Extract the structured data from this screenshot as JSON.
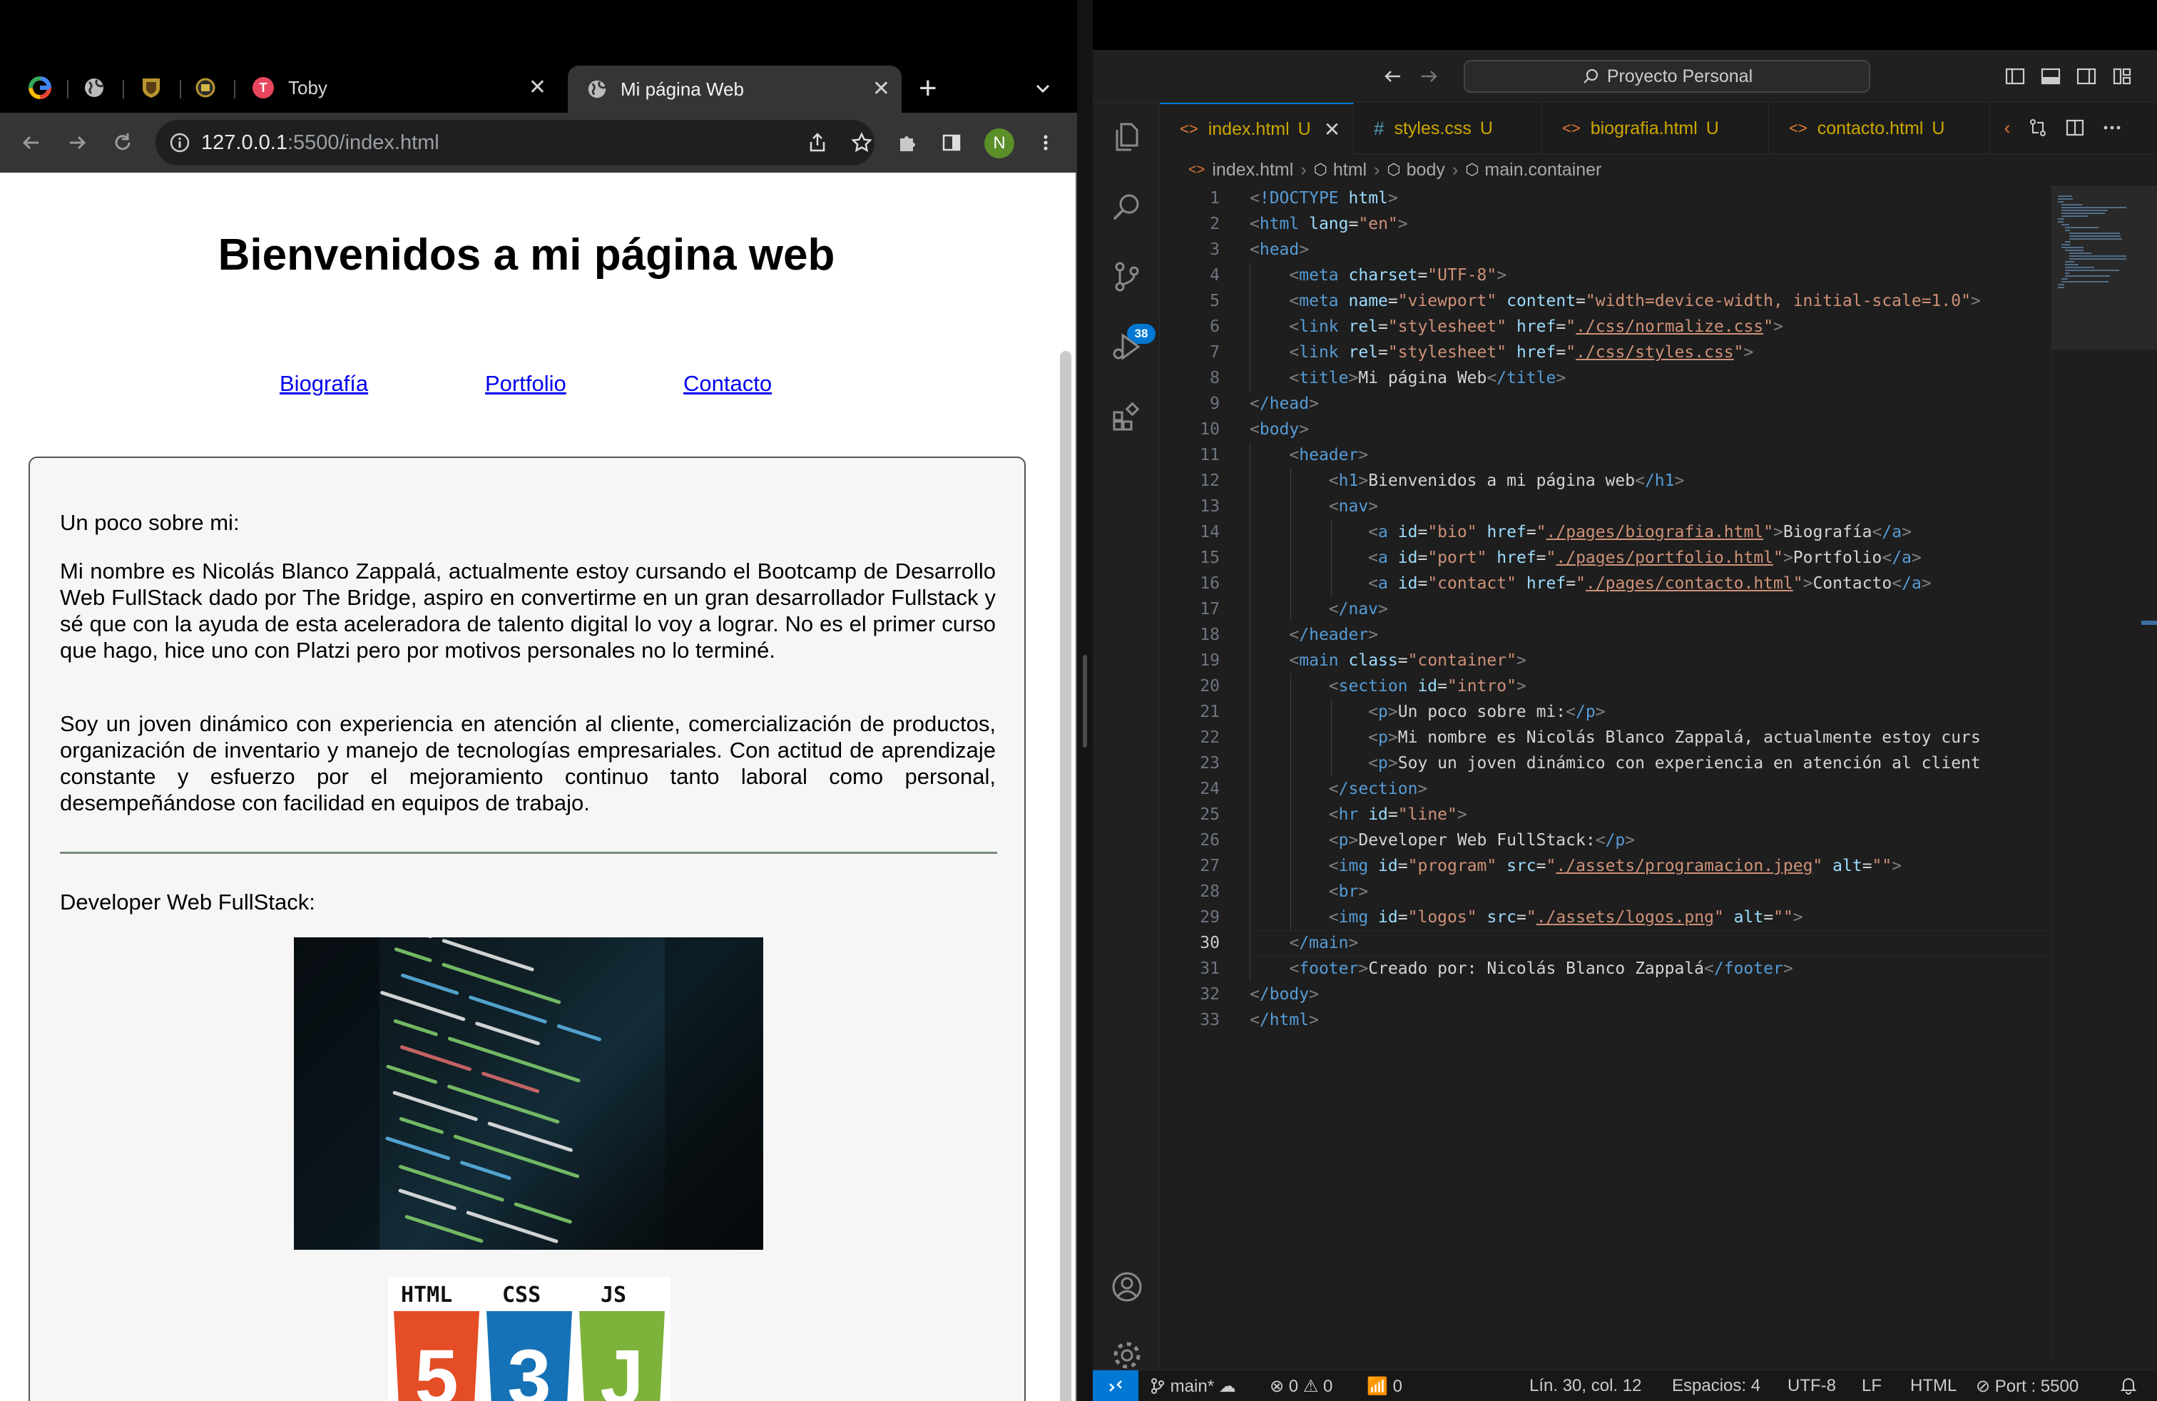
{
  "browser": {
    "tabs": [
      {
        "title": "Toby"
      },
      {
        "title": "Mi página Web",
        "active": true
      }
    ],
    "url_host": "127.0.0.1",
    "url_rest": ":5500/index.html",
    "profile_initial": "N"
  },
  "page": {
    "heading": "Bienvenidos a mi página web",
    "nav": [
      "Biografía",
      "Portfolio",
      "Contacto"
    ],
    "intro_label": "Un poco sobre mi:",
    "paragraph1": "Mi nombre es Nicolás Blanco Zappalá, actualmente estoy cursando el Bootcamp de Desarrollo Web FullStack dado por The Bridge, aspiro en convertirme en un gran desarrollador Fullstack y sé que con la ayuda de esta aceleradora de talento digital lo voy a lograr. No es el primer curso que hago, hice uno con Platzi pero por motivos personales no lo terminé.",
    "paragraph2": "Soy un joven dinámico con experiencia en atención al cliente, comercialización de productos, organización de inventario y manejo de tecnologías empresariales. Con actitud de aprendizaje constante y esfuerzo por el mejoramiento continuo tanto laboral como personal, desempeñándose con facilidad en equipos de trabajo.",
    "developer_label": "Developer Web FullStack:",
    "logo_labels": [
      "HTML",
      "CSS",
      "JS"
    ],
    "logo_glyphs": [
      "5",
      "3",
      "J"
    ]
  },
  "editor": {
    "command_center": "Proyecto Personal",
    "tabs": [
      {
        "name": "index.html",
        "status": "U",
        "active": true
      },
      {
        "name": "styles.css",
        "status": "U"
      },
      {
        "name": "biografia.html",
        "status": "U"
      },
      {
        "name": "contacto.html",
        "status": "U"
      }
    ],
    "breadcrumbs": [
      "index.html",
      "html",
      "body",
      "main.container"
    ],
    "scm_badge": "38",
    "current_line": 30,
    "code_lines": [
      "<!DOCTYPE html>",
      "<html lang=\"en\">",
      "<head>",
      "    <meta charset=\"UTF-8\">",
      "    <meta name=\"viewport\" content=\"width=device-width, initial-scale=1.0\">",
      "    <link rel=\"stylesheet\" href=\"./css/normalize.css\">",
      "    <link rel=\"stylesheet\" href=\"./css/styles.css\">",
      "    <title>Mi página Web</title>",
      "</head>",
      "<body>",
      "    <header>",
      "        <h1>Bienvenidos a mi página web</h1>",
      "        <nav>",
      "            <a id=\"bio\" href=\"./pages/biografia.html\">Biografía</a>",
      "            <a id=\"port\" href=\"./pages/portfolio.html\">Portfolio</a>",
      "            <a id=\"contact\" href=\"./pages/contacto.html\">Contacto</a>",
      "        </nav>",
      "    </header>",
      "    <main class=\"container\">",
      "        <section id=\"intro\">",
      "            <p>Un poco sobre mi:</p>",
      "            <p>Mi nombre es Nicolás Blanco Zappalá, actualmente estoy curs",
      "            <p>Soy un joven dinámico con experiencia en atención al client",
      "        </section>",
      "        <hr id=\"line\">",
      "        <p>Developer Web FullStack:</p>",
      "        <img id=\"program\" src=\"./assets/programacion.jpeg\" alt=\"\">",
      "        <br>",
      "        <img id=\"logos\" src=\"./assets/logos.png\" alt=\"\">",
      "    </main>",
      "    <footer>Creado por: Nicolás Blanco Zappalá</footer>",
      "</body>",
      "</html>"
    ]
  },
  "status": {
    "branch": "main*",
    "errors": "0",
    "warnings": "0",
    "ports": "0",
    "position": "Lín. 30, col. 12",
    "spaces": "Espacios: 4",
    "encoding": "UTF-8",
    "eol": "LF",
    "language": "HTML",
    "port": "Port : 5500"
  },
  "colors": {
    "accent": "#0078d4",
    "link": "#0000ee",
    "modified": "#cca700",
    "html5": "#e44d26",
    "css3": "#1572b6",
    "js": "#7db33a"
  }
}
